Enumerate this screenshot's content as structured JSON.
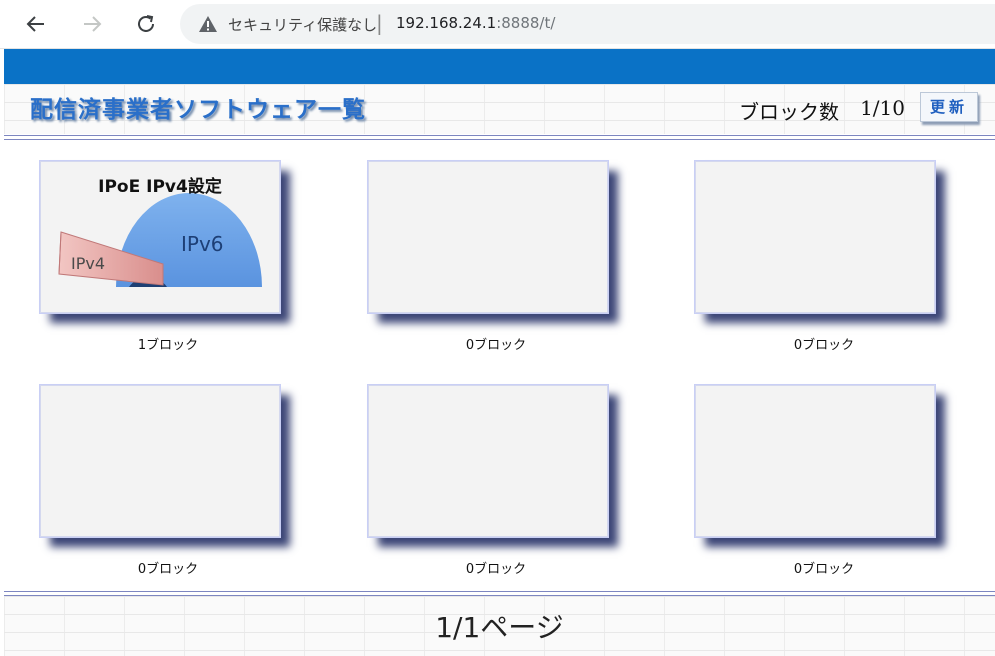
{
  "browser": {
    "security_text": "セキュリティ保護なし",
    "url_host": "192.168.24.1",
    "url_path": ":8888/t/"
  },
  "header": {
    "title": "配信済事業者ソフトウェア一覧",
    "block_count_label": "ブロック数",
    "block_count_value": "1/10",
    "refresh_label": "更新"
  },
  "tiles": [
    {
      "caption": "1ブロック",
      "art_title": "IPoE IPv4設定",
      "art_ipv6": "IPv6",
      "art_ipv4": "IPv4"
    },
    {
      "caption": "0ブロック"
    },
    {
      "caption": "0ブロック"
    },
    {
      "caption": "0ブロック"
    },
    {
      "caption": "0ブロック"
    },
    {
      "caption": "0ブロック"
    }
  ],
  "footer": {
    "pager": "1/1ページ"
  },
  "colors": {
    "band": "#0a72c6",
    "title": "#2a6fc9",
    "rule": "#7d86c0"
  }
}
